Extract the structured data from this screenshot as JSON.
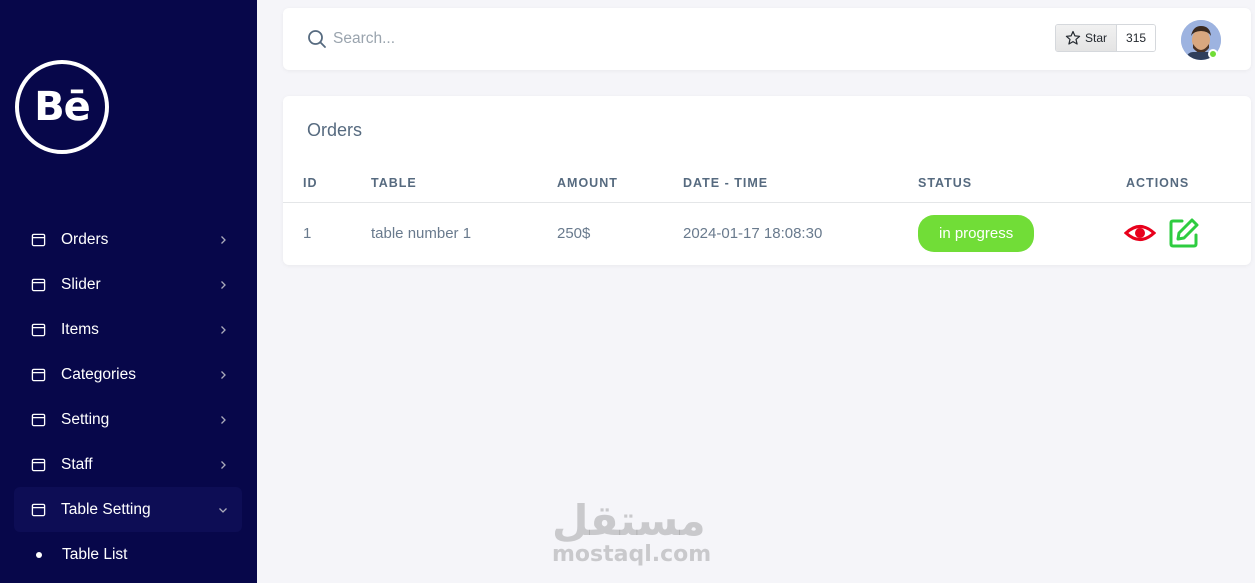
{
  "brand": {
    "logo_text": "Bē"
  },
  "sidebar": {
    "items": [
      {
        "label": "Orders",
        "icon": "calendar-icon",
        "expanded": false
      },
      {
        "label": "Slider",
        "icon": "calendar-icon",
        "expanded": false
      },
      {
        "label": "Items",
        "icon": "calendar-icon",
        "expanded": false
      },
      {
        "label": "Categories",
        "icon": "calendar-icon",
        "expanded": false
      },
      {
        "label": "Setting",
        "icon": "calendar-icon",
        "expanded": false
      },
      {
        "label": "Staff",
        "icon": "calendar-icon",
        "expanded": false
      },
      {
        "label": "Table Setting",
        "icon": "calendar-icon",
        "expanded": true
      }
    ],
    "sub_items": [
      {
        "label": "Table List"
      }
    ]
  },
  "navbar": {
    "search_placeholder": "Search...",
    "star_label": "Star",
    "star_count": "315"
  },
  "orders": {
    "title": "Orders",
    "columns": [
      "ID",
      "TABLE",
      "AMOUNT",
      "DATE - TIME",
      "STATUS",
      "ACTIONS"
    ],
    "rows": [
      {
        "id": "1",
        "table": "table number 1",
        "amount": "250$",
        "datetime": "2024-01-17 18:08:30",
        "status": "in progress"
      }
    ]
  },
  "colors": {
    "sidebar": "#07074a",
    "status_in_progress": "#71dd37",
    "view_icon": "#e8001c",
    "edit_icon": "#2ecc40"
  },
  "watermark": {
    "arabic": "مستقل",
    "latin": "mostaql.com"
  }
}
